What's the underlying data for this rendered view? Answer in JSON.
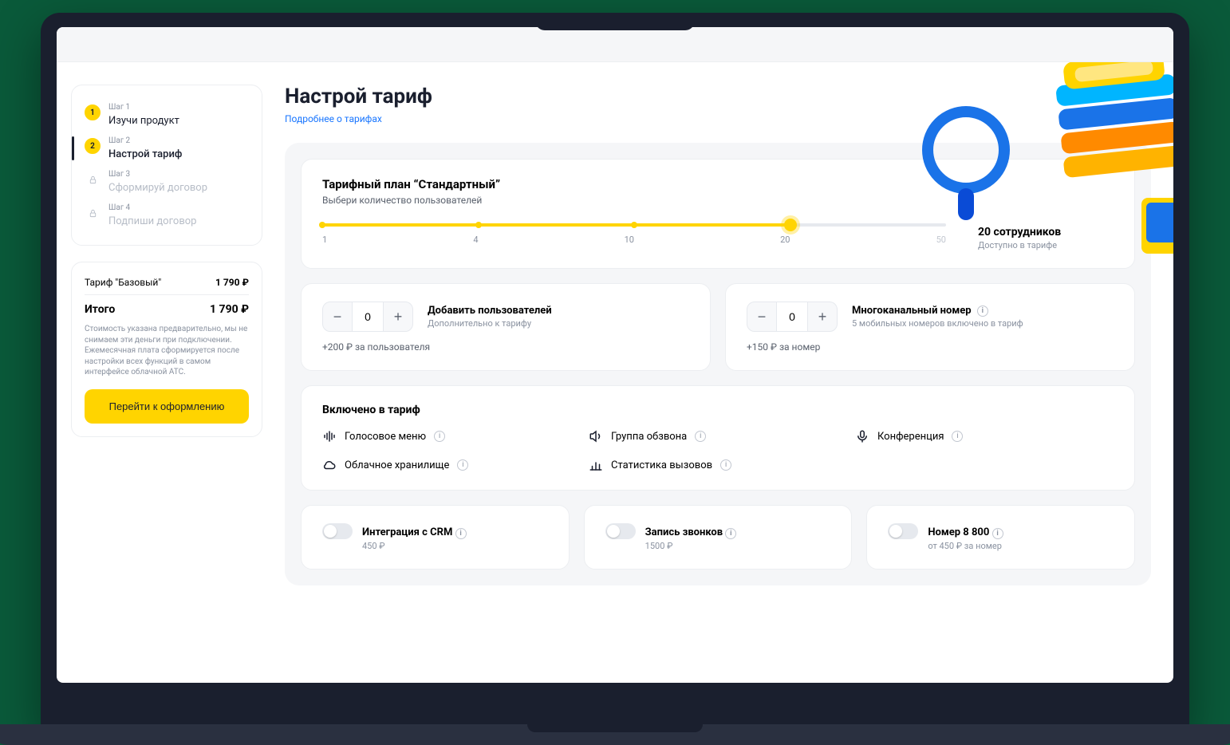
{
  "colors": {
    "accent": "#ffd400",
    "link": "#1976ff"
  },
  "page": {
    "title": "Настрой тариф",
    "more_link": "Подробнее о тарифах"
  },
  "steps": [
    {
      "num": "1",
      "label_small": "Шаг 1",
      "label": "Изучи продукт",
      "state": "done"
    },
    {
      "num": "2",
      "label_small": "Шаг 2",
      "label": "Настрой тариф",
      "state": "active"
    },
    {
      "num": "",
      "label_small": "Шаг 3",
      "label": "Сформируй договор",
      "state": "locked"
    },
    {
      "num": "",
      "label_small": "Шаг 4",
      "label": "Подпиши договор",
      "state": "locked"
    }
  ],
  "summary": {
    "plan_label": "Тариф \"Базовый\"",
    "plan_price": "1 790 ₽",
    "total_label": "Итого",
    "total_price": "1 790 ₽",
    "disclaimer": "Стоимость указана предварительно, мы не снимаем эти деньги при подключении. Ежемесячная плата сформируется после настройки всех функций в самом интерфейсе облачной АТС.",
    "cta": "Перейти к оформлению"
  },
  "plan": {
    "title": "Тарифный план “Стандартный”",
    "subtitle": "Выбери количество пользователей",
    "ticks": [
      "1",
      "4",
      "10",
      "20",
      "50"
    ],
    "value_label": "20 сотрудников",
    "value_sub": "Доступно в тарифе",
    "fill_percent": 75
  },
  "add_users": {
    "value": "0",
    "title": "Добавить пользователей",
    "sub": "Дополнительно к тарифу",
    "price": "+200 ₽ за пользователя"
  },
  "add_number": {
    "value": "0",
    "title": "Многоканальный номер",
    "sub": "5 мобильных номеров включено в тариф",
    "price": "+150 ₽ за номер"
  },
  "included": {
    "title": "Включено в тариф",
    "items": [
      {
        "icon": "voice-menu-icon",
        "label": "Голосовое меню"
      },
      {
        "icon": "call-group-icon",
        "label": "Группа обзвона"
      },
      {
        "icon": "conference-icon",
        "label": "Конференция"
      },
      {
        "icon": "cloud-storage-icon",
        "label": "Облачное хранилище"
      },
      {
        "icon": "call-stats-icon",
        "label": "Статистика вызовов"
      }
    ]
  },
  "addons": [
    {
      "title": "Интеграция с CRM",
      "price": "450 ₽"
    },
    {
      "title": "Запись звонков",
      "price": "1500 ₽"
    },
    {
      "title": "Номер 8 800",
      "price": "от 450 ₽ за номер"
    }
  ]
}
